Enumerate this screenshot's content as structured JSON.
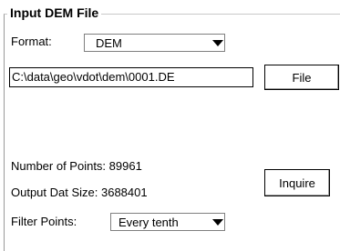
{
  "group": {
    "title": "Input DEM File"
  },
  "format": {
    "label": "Format:",
    "value": "DEM"
  },
  "file": {
    "path": "C:\\data\\geo\\vdot\\dem\\0001.DE",
    "button_label": "File"
  },
  "info": {
    "points_label": "Number of Points: 89961",
    "size_label": "Output Dat Size: 3688401",
    "inquire_label": "Inquire"
  },
  "filter": {
    "label": "Filter Points:",
    "value": "Every tenth"
  },
  "icons": {
    "dropdown": "dropdown-arrow-icon"
  }
}
